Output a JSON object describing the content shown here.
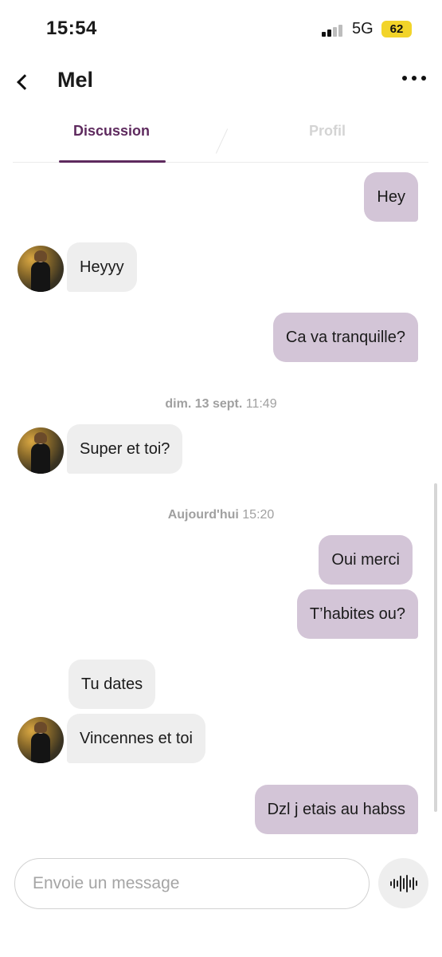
{
  "status_bar": {
    "time": "15:54",
    "network": "5G",
    "battery": "62"
  },
  "header": {
    "name": "Mel"
  },
  "tabs": [
    {
      "label": "Discussion"
    },
    {
      "label": "Profil"
    }
  ],
  "messages": [
    {
      "text": "Hey",
      "direction": "out"
    },
    {
      "text": "Heyyy",
      "direction": "in"
    },
    {
      "text": "Ca va tranquille?",
      "direction": "out"
    },
    {
      "text": "Super et toi?",
      "direction": "in"
    },
    {
      "text": "Oui merci",
      "direction": "out"
    },
    {
      "text": "T’habites ou?",
      "direction": "out"
    },
    {
      "text": "Tu dates",
      "direction": "in"
    },
    {
      "text": "Vincennes et toi",
      "direction": "in"
    },
    {
      "text": "Dzl j etais au habss",
      "direction": "out"
    }
  ],
  "date_separators": [
    {
      "day": "dim. 13 sept.",
      "time": "11:49"
    },
    {
      "day": "Aujourd'hui",
      "time": "15:20"
    }
  ],
  "input": {
    "placeholder": "Envoie un message"
  },
  "icons": {
    "back": "chevron-left-icon",
    "more": "more-dots-icon",
    "voice": "voice-waveform-icon"
  },
  "colors": {
    "accent": "#5e2a5e",
    "outgoing_bubble": "#d3c5d7",
    "incoming_bubble": "#eeeeee"
  }
}
